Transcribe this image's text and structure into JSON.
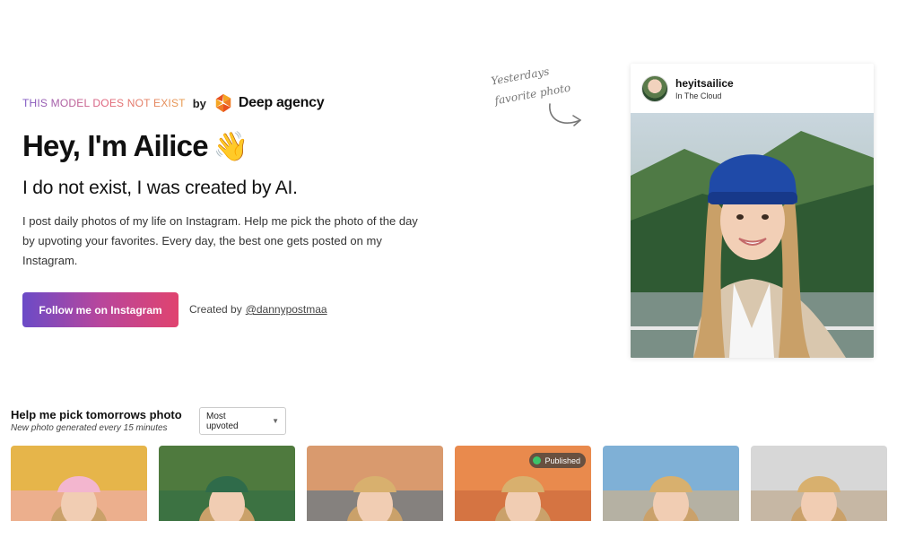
{
  "hero": {
    "tag": "THIS MODEL DOES NOT EXIST",
    "by": "by",
    "agency": "Deep agency",
    "title": "Hey, I'm Ailice",
    "wave": "👋",
    "subtitle": "I do not exist, I was created by AI.",
    "description": "I post daily photos of my life on Instagram. Help me pick the photo of the day by upvoting your favorites. Every day, the best one gets posted on my Instagram.",
    "follow_label": "Follow me on Instagram",
    "created_by": "Created by",
    "creator_link": "@dannypostmaa"
  },
  "note": {
    "line1": "Yesterdays",
    "line2": "favorite photo"
  },
  "card": {
    "username": "heyitsailice",
    "location": "In The Cloud"
  },
  "gallery": {
    "title": "Help me pick tomorrows photo",
    "subtitle": "New photo generated every 15 minutes",
    "sort_value": "Most upvoted",
    "badge": "Published",
    "thumbnails": [
      {
        "name": "photo-1",
        "bg": "#e6b54a",
        "accent": "#f0a9c4"
      },
      {
        "name": "photo-2",
        "bg": "#4f7a3e",
        "accent": "#2e6b45"
      },
      {
        "name": "photo-3",
        "bg": "#d99a6e",
        "accent": "#3f6d8c"
      },
      {
        "name": "photo-4",
        "bg": "#e98a4d",
        "accent": "#c4623a"
      },
      {
        "name": "photo-5",
        "bg": "#7fb0d6",
        "accent": "#e2b27a"
      },
      {
        "name": "photo-6",
        "bg": "#d7d7d7",
        "accent": "#b89d7a"
      }
    ]
  },
  "colors": {
    "brand_gradient_start": "#6b4bc7",
    "brand_gradient_end": "#e0436f",
    "published_dot": "#3cc46a"
  }
}
